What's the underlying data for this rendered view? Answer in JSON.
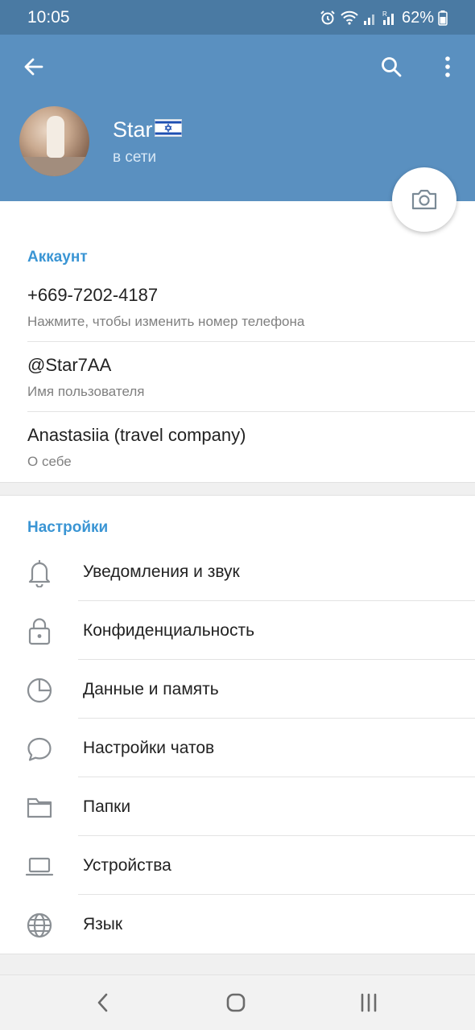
{
  "status_bar": {
    "time": "10:05",
    "battery": "62%"
  },
  "header": {
    "name": "Star",
    "flag": "🇮🇱",
    "status": "в сети"
  },
  "account": {
    "section_title": "Аккаунт",
    "phone": "+669-7202-4187",
    "phone_hint": "Нажмите, чтобы изменить номер телефона",
    "username": "@Star7AA",
    "username_hint": "Имя пользователя",
    "bio": "Anastasiia (travel company)",
    "bio_hint": "О себе"
  },
  "settings": {
    "section_title": "Настройки",
    "items": [
      {
        "label": "Уведомления и звук",
        "icon": "bell-icon"
      },
      {
        "label": "Конфиденциальность",
        "icon": "lock-icon"
      },
      {
        "label": "Данные и память",
        "icon": "pie-chart-icon"
      },
      {
        "label": "Настройки чатов",
        "icon": "chat-bubble-icon"
      },
      {
        "label": "Папки",
        "icon": "folder-icon"
      },
      {
        "label": "Устройства",
        "icon": "laptop-icon"
      },
      {
        "label": "Язык",
        "icon": "globe-icon"
      }
    ]
  },
  "colors": {
    "header": "#5a90c0",
    "status_bar": "#4a7aa3",
    "accent": "#3a95d4"
  }
}
